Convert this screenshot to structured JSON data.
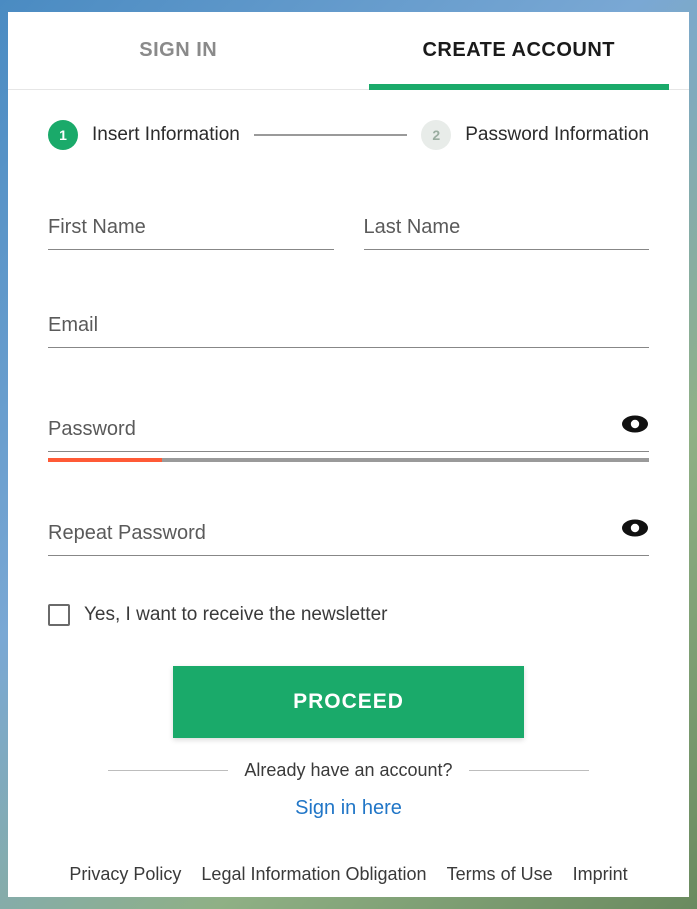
{
  "tabs": {
    "signin": "SIGN IN",
    "create": "CREATE ACCOUNT"
  },
  "steps": {
    "one_num": "1",
    "one_label": "Insert Information",
    "two_num": "2",
    "two_label": "Password Information"
  },
  "fields": {
    "first_name": "First Name",
    "last_name": "Last Name",
    "email": "Email",
    "password": "Password",
    "repeat_password": "Repeat Password"
  },
  "newsletter": {
    "label": "Yes, I want to receive the newsletter"
  },
  "actions": {
    "proceed": "PROCEED",
    "already": "Already have an account?",
    "signin_here": "Sign in here"
  },
  "footer": {
    "privacy": "Privacy Policy",
    "legal": "Legal Information Obligation",
    "terms": "Terms of Use",
    "imprint": "Imprint"
  }
}
